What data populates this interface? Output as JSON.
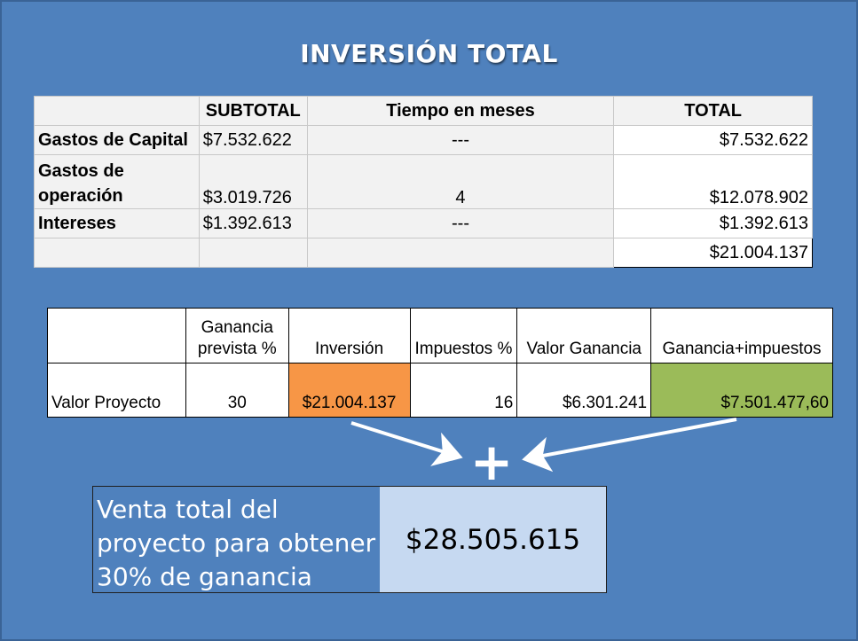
{
  "title": "INVERSIÓN TOTAL",
  "inversion_table": {
    "headers": [
      "",
      "SUBTOTAL",
      "Tiempo en meses",
      "TOTAL"
    ],
    "rows": [
      {
        "label": "Gastos de Capital",
        "subtotal": "$7.532.622",
        "meses": "---",
        "total": "$7.532.622"
      },
      {
        "label": "Gastos de operación",
        "subtotal": "$3.019.726",
        "meses": "4",
        "total": "$12.078.902"
      },
      {
        "label": "Intereses",
        "subtotal": "$1.392.613",
        "meses": "---",
        "total": "$1.392.613"
      }
    ],
    "grand_total": "$21.004.137"
  },
  "proyecto_table": {
    "headers": [
      "",
      "Ganancia prevista %",
      "Inversión",
      "Impuestos %",
      "Valor Ganancia",
      "Ganancia+impuestos"
    ],
    "row": {
      "label": "Valor Proyecto",
      "ganancia_prevista": "30",
      "inversion": "$21.004.137",
      "impuestos": "16",
      "valor_ganancia": "$6.301.241",
      "ganancia_impuestos": "$7.501.477,60"
    }
  },
  "plus_symbol": "+",
  "summary": {
    "label": "Venta total del proyecto para obtener 30% de ganancia",
    "value": "$28.505.615"
  },
  "colors": {
    "background": "#4f81bd",
    "inversion_cell": "#f79646",
    "ganancia_cell": "#9bbb59",
    "summary_value_bg": "#c6d9f1"
  }
}
